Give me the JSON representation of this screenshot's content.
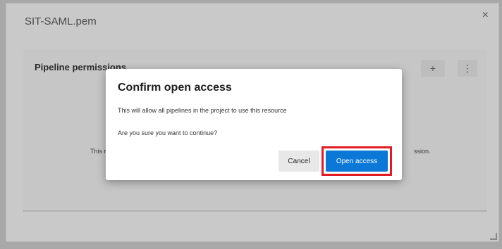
{
  "panel": {
    "title": "SIT-SAML.pem",
    "close_glyph": "×",
    "section_title": "Pipeline permissions",
    "add_glyph": "+",
    "more_glyph": "⋮",
    "bg_text_left": "This r",
    "bg_text_right": "ssion."
  },
  "dialog": {
    "title": "Confirm open access",
    "message": "This will allow all pipelines in the project to use this resource",
    "question": "Are you sure you want to continue?",
    "cancel_label": "Cancel",
    "confirm_label": "Open access"
  },
  "colors": {
    "accent": "#0b78d7",
    "highlight": "#e01b24"
  }
}
